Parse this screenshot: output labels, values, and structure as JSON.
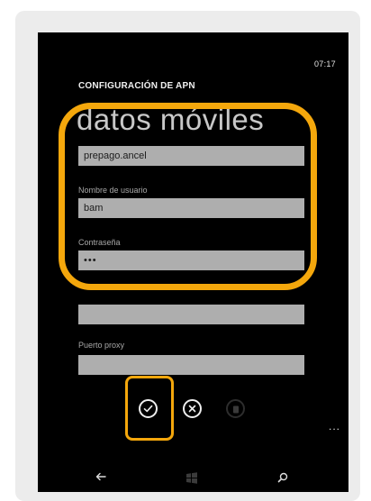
{
  "status_bar": {
    "time": "07:17"
  },
  "page": {
    "title": "CONFIGURACIÓN DE APN",
    "heading": "datos móviles"
  },
  "fields": {
    "apn": {
      "value": "prepago.ancel"
    },
    "username": {
      "label": "Nombre de usuario",
      "value": "bam"
    },
    "password": {
      "label": "Contraseña",
      "value": "•••"
    },
    "proxy_server": {
      "value": ""
    },
    "proxy_port": {
      "label": "Puerto proxy",
      "value": ""
    }
  },
  "app_bar": {
    "buttons": [
      {
        "name": "save",
        "icon": "checkmark-icon"
      },
      {
        "name": "cancel",
        "icon": "close-icon"
      },
      {
        "name": "delete",
        "icon": "trash-icon",
        "disabled": true
      }
    ],
    "more_label": "..."
  },
  "nav_bar": {
    "icons": [
      "back-arrow-icon",
      "windows-start-icon",
      "search-icon"
    ]
  },
  "colors": {
    "highlight": "#f4a70c",
    "field_bg": "#aeaeae",
    "background": "#000000"
  }
}
